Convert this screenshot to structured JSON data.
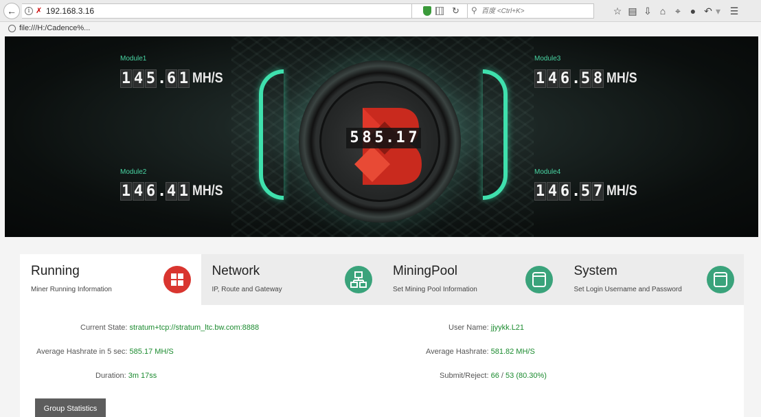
{
  "browser": {
    "url": "192.168.3.16",
    "search_placeholder": "百度 <Ctrl+K>",
    "bookmark_label": "file:///H:/Cadence%..."
  },
  "hero": {
    "modules": [
      {
        "label": "Module1",
        "digits": [
          "1",
          "4",
          "5",
          ".",
          "6",
          "1"
        ],
        "unit": "MH/S"
      },
      {
        "label": "Module2",
        "digits": [
          "1",
          "4",
          "6",
          ".",
          "4",
          "1"
        ],
        "unit": "MH/S"
      },
      {
        "label": "Module3",
        "digits": [
          "1",
          "4",
          "6",
          ".",
          "5",
          "8"
        ],
        "unit": "MH/S"
      },
      {
        "label": "Module4",
        "digits": [
          "1",
          "4",
          "6",
          ".",
          "5",
          "7"
        ],
        "unit": "MH/S"
      }
    ],
    "total": [
      "5",
      "8",
      "5",
      ".",
      "1",
      "7"
    ],
    "accent_color": "#3fe0ad"
  },
  "tabs": [
    {
      "title": "Running",
      "subtitle": "Miner Running Information",
      "icon": "grid-icon",
      "active": true
    },
    {
      "title": "Network",
      "subtitle": "IP, Route and Gateway",
      "icon": "network-icon",
      "active": false
    },
    {
      "title": "MiningPool",
      "subtitle": "Set Mining Pool Information",
      "icon": "pool-icon",
      "active": false
    },
    {
      "title": "System",
      "subtitle": "Set Login Username and Password",
      "icon": "system-icon",
      "active": false
    }
  ],
  "running": {
    "current_state_label": "Current State:",
    "current_state": "stratum+tcp://stratum_ltc.bw.com:8888",
    "avg_5s_label": "Average Hashrate in 5 sec:",
    "avg_5s": "585.17 MH/S",
    "duration_label": "Duration:",
    "duration": "3m 17ss",
    "user_label": "User Name:",
    "user": "jjyykk.L21",
    "avg_label": "Average Hashrate:",
    "avg": "581.82 MH/S",
    "submit_label": "Submit/Reject:",
    "submit": "66",
    "slash": "/",
    "reject": "53 (80.30%)"
  },
  "group_button": "Group Statistics"
}
